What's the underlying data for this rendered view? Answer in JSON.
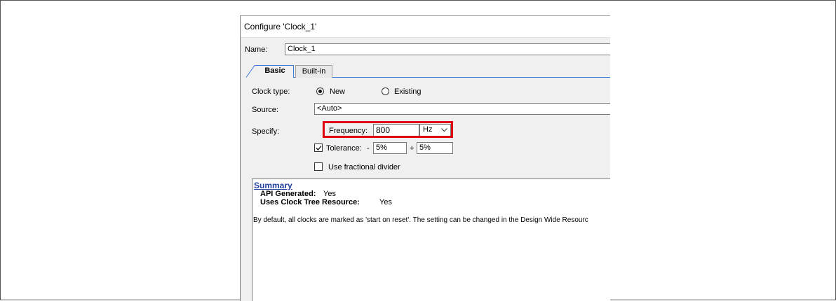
{
  "dialog": {
    "title": "Configure 'Clock_1'"
  },
  "name_row": {
    "label": "Name:",
    "value": "Clock_1"
  },
  "tabs": [
    {
      "label": "Basic",
      "selected": true
    },
    {
      "label": "Built-in",
      "selected": false
    }
  ],
  "clock_type": {
    "label": "Clock type:",
    "options": [
      {
        "label": "New",
        "selected": true
      },
      {
        "label": "Existing",
        "selected": false
      }
    ]
  },
  "source": {
    "label": "Source:",
    "value": "<Auto>"
  },
  "specify": {
    "label": "Specify:",
    "frequency_label": "Frequency:",
    "frequency_value": "800",
    "unit_value": "Hz",
    "tolerance": {
      "label": "Tolerance:",
      "checked": true,
      "minus_sign": "-",
      "minus_value": "5%",
      "plus_sign": "+",
      "plus_value": "5%"
    },
    "fractional_divider": {
      "label": "Use fractional divider",
      "checked": false
    }
  },
  "summary": {
    "heading": "Summary",
    "api_generated_label": "API Generated:",
    "api_generated_value": "Yes",
    "clock_tree_label": "Uses Clock Tree Resource:",
    "clock_tree_value": "Yes",
    "note": "By default, all clocks are marked as 'start on reset'. The setting can be changed in the Design Wide Resourc"
  },
  "colors": {
    "highlight": "#e0000f",
    "summary_link": "#1f3f9f",
    "tab_accent": "#3c78d8"
  },
  "icons": {
    "unit_dropdown": "chevron-down-icon",
    "checkbox_mark": "checkmark-icon"
  }
}
